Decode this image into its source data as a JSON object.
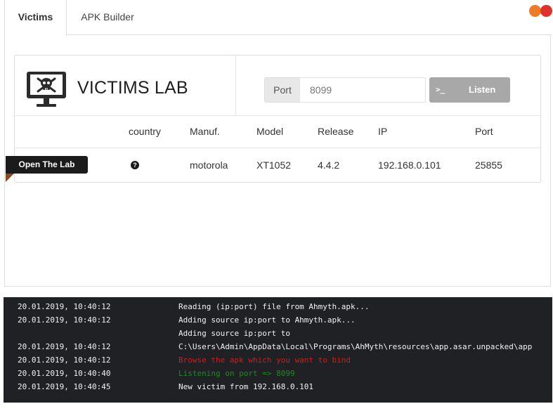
{
  "tabs": [
    {
      "label": "Victims",
      "active": true
    },
    {
      "label": "APK Builder",
      "active": false
    }
  ],
  "window_controls": {
    "colors": [
      "#ef7b26",
      "#e0312c"
    ]
  },
  "lab": {
    "title": "VICTIMS LAB",
    "icon": "monitor-skull-icon",
    "port_label": "Port",
    "port_placeholder": "8099",
    "listen_prompt": ">_",
    "listen_label": "Listen"
  },
  "table": {
    "headers": [
      "country",
      "Manuf.",
      "Model",
      "Release",
      "IP",
      "Port"
    ],
    "rows": [
      {
        "action_label": "Open The Lab",
        "country_icon": "question-circle-icon",
        "manuf": "motorola",
        "model": "XT1052",
        "release": "4.4.2",
        "ip": "192.168.0.101",
        "port": "25855"
      }
    ]
  },
  "log": [
    {
      "time": "20.01.2019, 10:40:12",
      "msg": "Reading (ip:port) file from Ahmyth.apk...",
      "status": "info"
    },
    {
      "time": "20.01.2019, 10:40:12",
      "msg": "Adding source ip:port to Ahmyth.apk...",
      "status": "info"
    },
    {
      "time": "",
      "msg": "Adding source ip:port to",
      "status": "info"
    },
    {
      "time": "20.01.2019, 10:40:12",
      "msg": "C:\\Users\\Admin\\AppData\\Local\\Programs\\AhMyth\\resources\\app.asar.unpacked\\app",
      "status": "info"
    },
    {
      "time": "20.01.2019, 10:40:12",
      "msg": "Browse the apk which you want to bind",
      "status": "error"
    },
    {
      "time": "20.01.2019, 10:40:40",
      "msg": "Listening on port => 8099",
      "status": "success"
    },
    {
      "time": "20.01.2019, 10:40:45",
      "msg": "New victim from 192.168.0.101",
      "status": "info"
    }
  ],
  "colors": {
    "error": "#c91f1f",
    "success": "#1f8a1f",
    "console_bg": "#1f2125",
    "button": "#a8a8a8"
  }
}
